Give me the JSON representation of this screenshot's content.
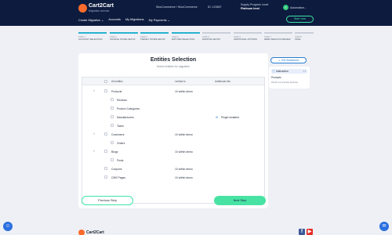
{
  "header": {
    "logo_text": "Cart2Cart",
    "logo_sub": "Migration service",
    "migration_pair": "WooCommerce / WooCommerce",
    "migration_id": "ID: 123657",
    "support_label": "Supply Program Level",
    "support_value": "Platinum level",
    "user_initial": "S",
    "user_name": "Automation...",
    "start_new": "Start new",
    "nav": [
      "Create Migration ⌄",
      "Accounts",
      "My Migrations",
      "My Payments ⌄"
    ]
  },
  "steps": [
    {
      "num": "STEP 1",
      "name": "ACCOUNT SELECTION",
      "done": true
    },
    {
      "num": "STEP 2",
      "name": "SOURCE STORE SETUP",
      "done": true
    },
    {
      "num": "STEP 3",
      "name": "TARGET STORE SETUP",
      "done": true
    },
    {
      "num": "STEP 4",
      "name": "ENTITIES SELECTION",
      "done": true
    },
    {
      "num": "STEP 5",
      "name": "MAPPING SETUP",
      "done": false
    },
    {
      "num": "STEP 6",
      "name": "ADDITIONAL OPTIONS",
      "done": false
    },
    {
      "num": "STEP 7",
      "name": "DEMO RESULTS REVIEW",
      "done": false
    },
    {
      "num": "STEP 8",
      "name": "FINAL",
      "done": false
    }
  ],
  "card": {
    "title": "Entities Selection",
    "subtitle": "Select entities for migration"
  },
  "table": {
    "headers": [
      "All entities",
      "Limited to",
      "Additional info"
    ],
    "rows": [
      {
        "level": 0,
        "caret": "˄",
        "label": "Products",
        "limit": "10 within demo",
        "info": ""
      },
      {
        "level": 1,
        "caret": "",
        "label": "Reviews",
        "limit": "",
        "info": ""
      },
      {
        "level": 1,
        "caret": "",
        "label": "Product Categories",
        "limit": "",
        "info": ""
      },
      {
        "level": 1,
        "caret": "",
        "label": "Manufacturers",
        "limit": "",
        "info": "Plugin installed"
      },
      {
        "level": 1,
        "caret": "",
        "label": "Taxes",
        "limit": "",
        "info": ""
      },
      {
        "level": 0,
        "caret": "˄",
        "label": "Customers",
        "limit": "10 within demo",
        "info": ""
      },
      {
        "level": 1,
        "caret": "",
        "label": "Orders",
        "limit": "",
        "info": ""
      },
      {
        "level": 0,
        "caret": "˄",
        "label": "Blogs",
        "limit": "10 within demo",
        "info": ""
      },
      {
        "level": 1,
        "caret": "",
        "label": "Posts",
        "limit": "",
        "info": ""
      },
      {
        "level": 0,
        "caret": "",
        "label": "Coupons",
        "limit": "10 within demo",
        "info": ""
      },
      {
        "level": 0,
        "caret": "",
        "label": "CMS Pages",
        "limit": "10 within demo",
        "info": ""
      }
    ]
  },
  "buttons": {
    "previous": "Previous Step",
    "next": "Next Step"
  },
  "assistance": "Get Assistance",
  "instructions": {
    "heading": "Instruction",
    "toggle": "‹ ›",
    "title": "Products",
    "text": "Plural Count Entity Exclude"
  },
  "footer": {
    "logo_text": "Cart2Cart"
  },
  "colors": {
    "header_bg": "#0d1b3e",
    "accent_green": "#48e3a4",
    "accent_blue": "#2a7fd3",
    "step_active": "#28b3cf"
  }
}
